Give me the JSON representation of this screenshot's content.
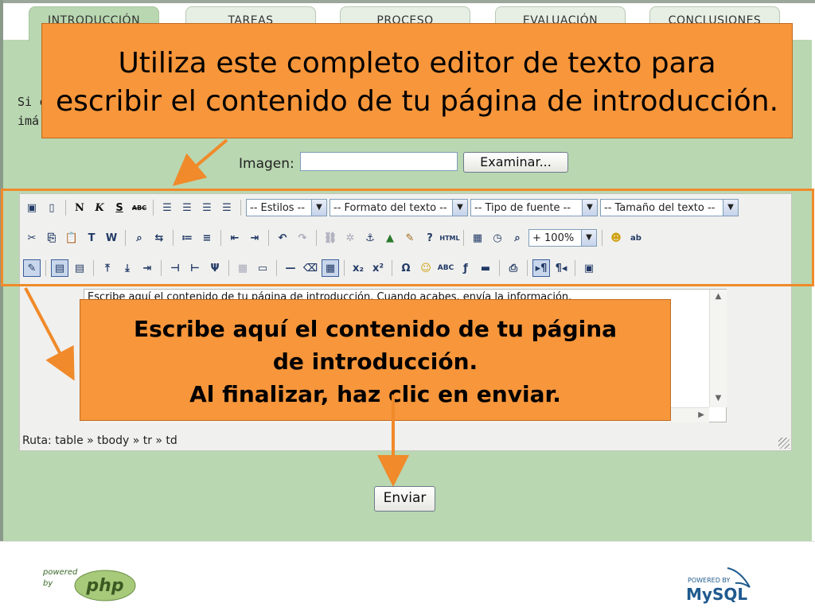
{
  "tabs": [
    {
      "label": "INTRODUCCIÓN",
      "active": true
    },
    {
      "label": "TAREAS",
      "active": false
    },
    {
      "label": "PROCESO",
      "active": false
    },
    {
      "label": "EVALUACIÓN",
      "active": false
    },
    {
      "label": "CONCLUSIONES",
      "active": false
    }
  ],
  "intro_text_line1": "Si c",
  "intro_text_line2": "imá",
  "image_label": "Imagen:",
  "image_input_value": "",
  "browse_button": "Examinar...",
  "editor": {
    "selects": {
      "styles": "-- Estilos --",
      "format": "-- Formato del texto --",
      "font": "-- Tipo de fuente --",
      "size": "-- Tamaño del texto --",
      "zoom": "+ 100%"
    },
    "content": "Escribe aquí el contenido de tu página de introducción. Cuando acabes, envía la información.",
    "path_label": "Ruta:",
    "path": "table » tbody » tr » td"
  },
  "callout_top": {
    "line1": "Utiliza este completo editor de texto para",
    "line2": "escribir el contenido de tu página de introducción."
  },
  "callout_bottom": {
    "line1": "Escribe aquí el contenido de tu página",
    "line2": "de introducción.",
    "line3": "Al finalizar, haz clic en enviar."
  },
  "send_button": "Enviar",
  "footer": {
    "php_small": "powered",
    "php_by": "by",
    "php_logo": "php",
    "mysql_small": "POWERED BY",
    "mysql_logo": "MySQL"
  },
  "colors": {
    "callout": "#f7963b",
    "panel": "#b9d7b1",
    "highlight": "#f08a2a",
    "arrow": "#f08a2a"
  }
}
